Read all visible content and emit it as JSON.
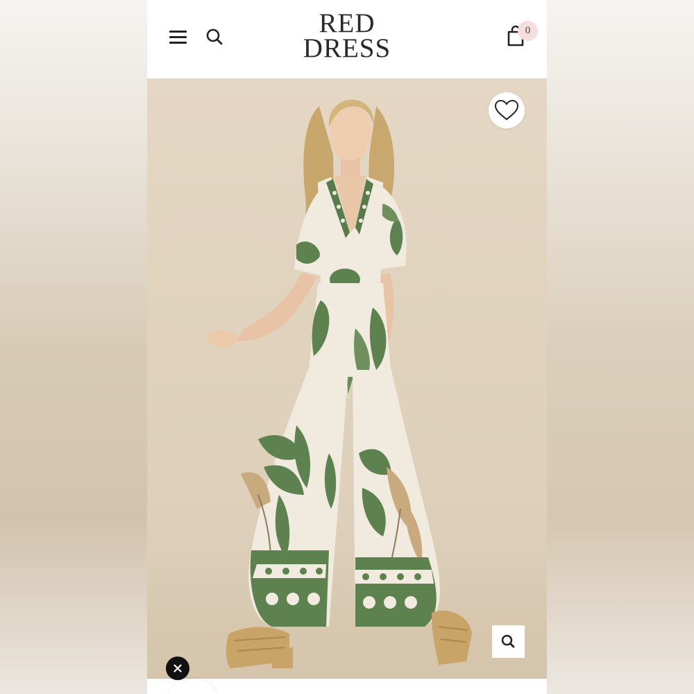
{
  "brand": {
    "logo_line1": "RED",
    "logo_line2": "DRESS"
  },
  "header": {
    "menu_icon": "hamburger-menu-icon",
    "search_icon": "search-icon",
    "cart_icon": "shopping-bag-icon",
    "cart_count": "0"
  },
  "product_image": {
    "favorite_icon": "heart-outline-icon",
    "zoom_icon": "magnifier-icon"
  },
  "overlay": {
    "close_icon": "close-icon"
  },
  "colors": {
    "badge_bg": "#f7dede",
    "print_green": "#5e8150",
    "fabric_cream": "#f1ebdf",
    "backdrop_beige": "#e0d3bf"
  }
}
